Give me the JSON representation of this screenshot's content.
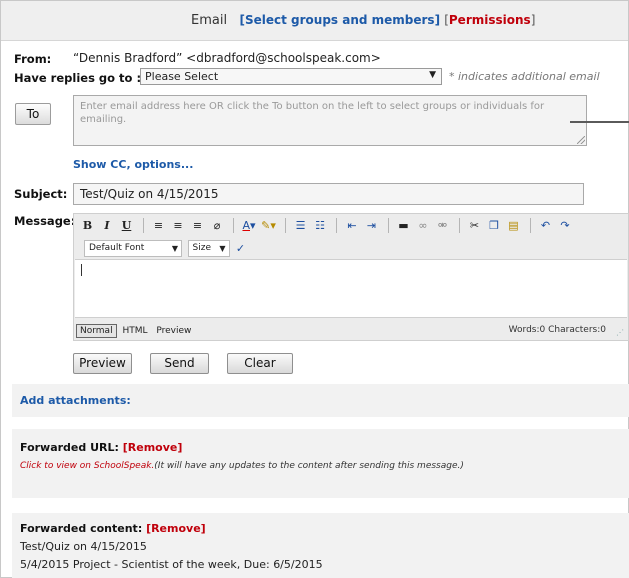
{
  "header": {
    "title": "Email",
    "groups_link": "[Select groups and members]",
    "permissions_bracket_open": "[",
    "permissions_link": "Permissions",
    "permissions_bracket_close": "]"
  },
  "from": {
    "label": "From:",
    "value": "“Dennis Bradford” <dbradford@schoolspeak.com>"
  },
  "replies": {
    "label": "Have replies go to :",
    "selected": "Please Select",
    "hint": "* indicates additional email"
  },
  "to": {
    "button_label": "To",
    "placeholder": "Enter email address here OR click the To button on the left to select groups or individuals for emailing."
  },
  "show_cc_label": "Show CC, options...",
  "subject": {
    "label": "Subject:",
    "value": "Test/Quiz on 4/15/2015"
  },
  "message": {
    "label": "Message:",
    "toolbar": {
      "bold": "B",
      "italic": "I",
      "underline": "U",
      "font_select": "Default Font",
      "size_select": "Size"
    },
    "modes": [
      "Normal",
      "HTML",
      "Preview"
    ],
    "counter": "Words:0 Characters:0"
  },
  "actions": {
    "preview": "Preview",
    "send": "Send",
    "clear": "Clear"
  },
  "attachments": {
    "label": "Add attachments:"
  },
  "forwarded_url": {
    "label": "Forwarded URL:",
    "remove": "[Remove]",
    "link_text": "Click to view on SchoolSpeak.",
    "note": "(It will have any updates to the content after sending this message.)"
  },
  "forwarded_content": {
    "label": "Forwarded content:",
    "remove": "[Remove]",
    "lines": [
      "Test/Quiz on 4/15/2015",
      "5/4/2015 Project - Scientist of the week, Due: 6/5/2015"
    ]
  },
  "icons": {
    "align_left": "align-left-icon",
    "align_center": "align-center-icon",
    "align_right": "align-right-icon",
    "eraser": "eraser-icon",
    "font_color": "font-color-icon",
    "highlight": "highlight-icon",
    "ordered_list": "ordered-list-icon",
    "unordered_list": "unordered-list-icon",
    "outdent": "outdent-icon",
    "indent": "indent-icon",
    "horizontal_rule": "horizontal-rule-icon",
    "link": "link-icon",
    "unlink": "unlink-icon",
    "cut": "cut-icon",
    "copy": "copy-icon",
    "paste": "paste-icon",
    "undo": "undo-icon",
    "redo": "redo-icon",
    "spellcheck": "spellcheck-icon"
  }
}
